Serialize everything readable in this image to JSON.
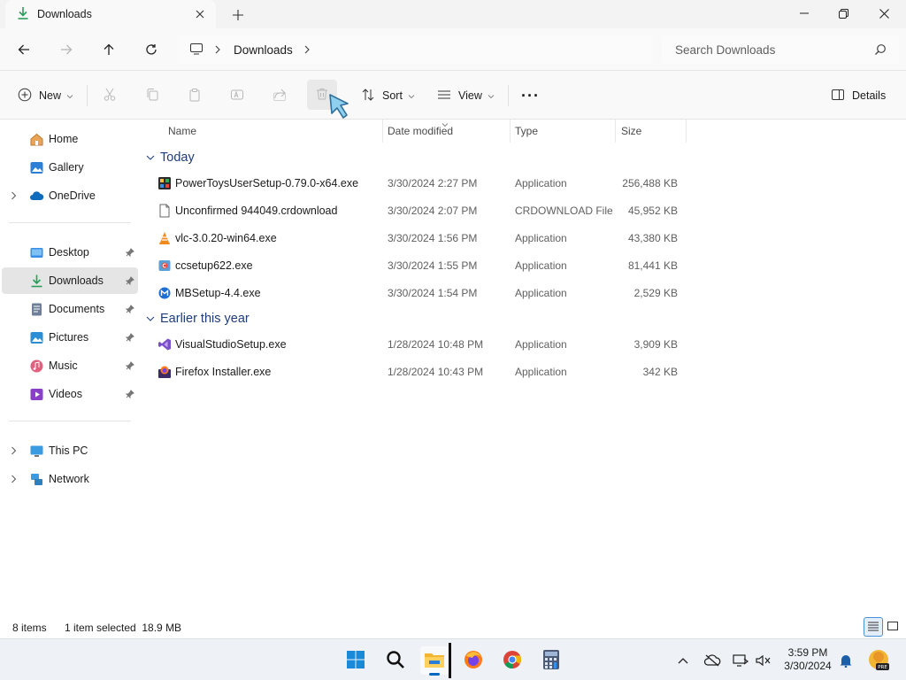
{
  "window": {
    "tab_title": "Downloads",
    "new_tab": "+"
  },
  "address": {
    "breadcrumb": [
      "Downloads"
    ],
    "search_placeholder": "Search Downloads"
  },
  "commands": {
    "new_label": "New",
    "sort_label": "Sort",
    "view_label": "View",
    "more_label": "···",
    "details_label": "Details"
  },
  "sidebar": {
    "items": [
      {
        "label": "Home",
        "icon": "home-icon"
      },
      {
        "label": "Gallery",
        "icon": "gallery-icon"
      },
      {
        "label": "OneDrive",
        "icon": "onedrive-icon"
      },
      {
        "label": "Desktop",
        "icon": "desktop-icon"
      },
      {
        "label": "Downloads",
        "icon": "download-icon"
      },
      {
        "label": "Documents",
        "icon": "documents-icon"
      },
      {
        "label": "Pictures",
        "icon": "pictures-icon"
      },
      {
        "label": "Music",
        "icon": "music-icon"
      },
      {
        "label": "Videos",
        "icon": "videos-icon"
      },
      {
        "label": "This PC",
        "icon": "this-pc-icon"
      },
      {
        "label": "Network",
        "icon": "network-icon"
      }
    ]
  },
  "columns": {
    "name": "Name",
    "date": "Date modified",
    "type": "Type",
    "size": "Size"
  },
  "groups": {
    "today": "Today",
    "earlier": "Earlier this year"
  },
  "files": [
    {
      "name": "PowerToysUserSetup-0.79.0-x64.exe",
      "date": "3/30/2024 2:27 PM",
      "type": "Application",
      "size": "256,488 KB",
      "icon": "powertoys-icon"
    },
    {
      "name": "Unconfirmed 944049.crdownload",
      "date": "3/30/2024 2:07 PM",
      "type": "CRDOWNLOAD File",
      "size": "45,952 KB",
      "icon": "blank-file-icon"
    },
    {
      "name": "vlc-3.0.20-win64.exe",
      "date": "3/30/2024 1:56 PM",
      "type": "Application",
      "size": "43,380 KB",
      "icon": "vlc-icon"
    },
    {
      "name": "ccsetup622.exe",
      "date": "3/30/2024 1:55 PM",
      "type": "Application",
      "size": "81,441 KB",
      "icon": "ccleaner-icon"
    },
    {
      "name": "MBSetup-4.4.exe",
      "date": "3/30/2024 1:54 PM",
      "type": "Application",
      "size": "2,529 KB",
      "icon": "malwarebytes-icon"
    },
    {
      "name": "VisualStudioSetup.exe",
      "date": "1/28/2024 10:48 PM",
      "type": "Application",
      "size": "3,909 KB",
      "icon": "visual-studio-icon"
    },
    {
      "name": "Firefox Installer.exe",
      "date": "1/28/2024 10:43 PM",
      "type": "Application",
      "size": "342 KB",
      "icon": "firefox-installer-icon"
    }
  ],
  "status": {
    "count": "8 items",
    "selection": "1 item selected  18.9 MB"
  },
  "clock": {
    "time": "3:59 PM",
    "date": "3/30/2024"
  },
  "colors": {
    "accent": "#0067c0",
    "group_header": "#1f3d7a",
    "sidebar_active": "#e5e5e5"
  }
}
